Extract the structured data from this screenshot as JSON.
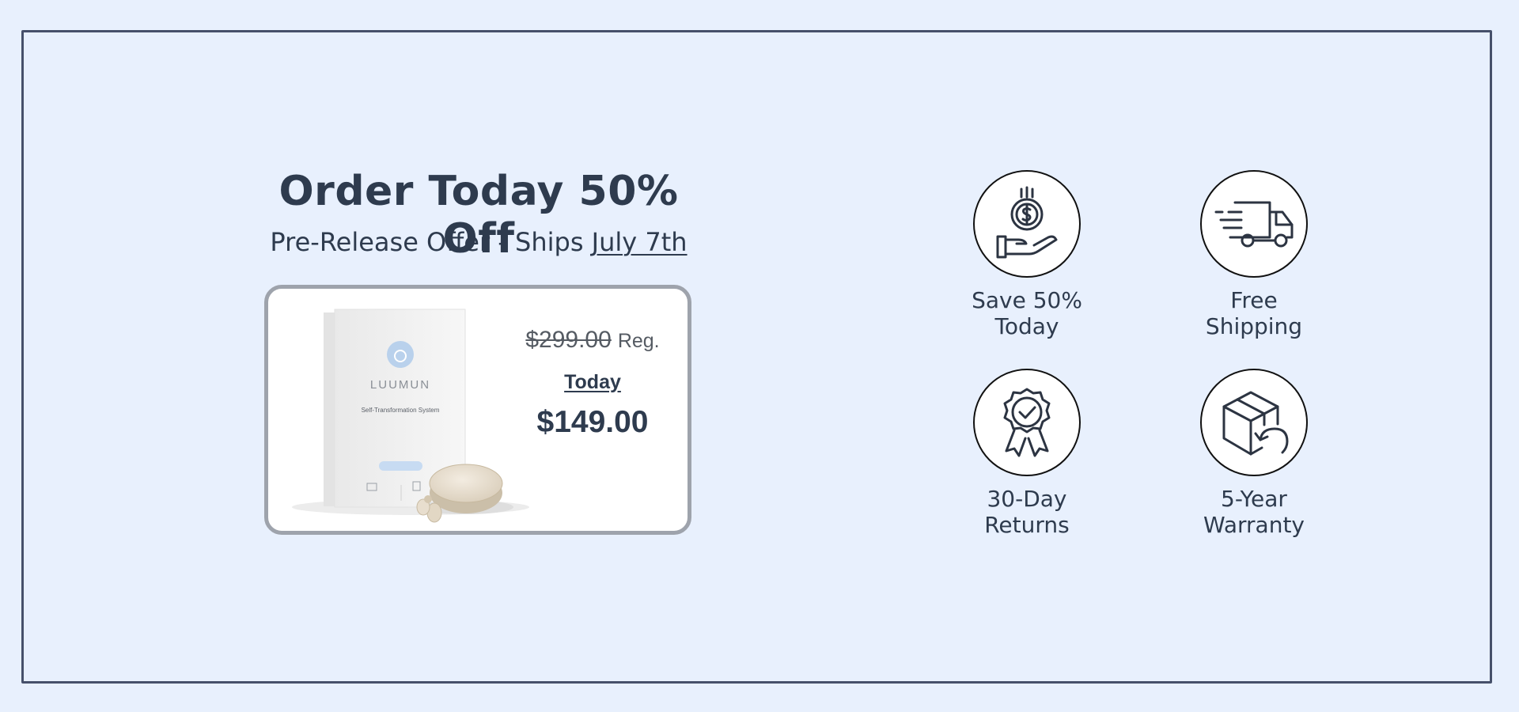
{
  "offer": {
    "headline": "Order Today 50% Off",
    "subhead_prefix": "Pre-Release Offer - Ships ",
    "ship_date": "July 7th"
  },
  "product": {
    "brand": "LUUMUN",
    "box_subtitle": "Self-Transformation System",
    "regular_price": "$299.00",
    "regular_label": "Reg.",
    "today_label": "Today",
    "today_price": "$149.00"
  },
  "features": [
    {
      "icon": "hand-coin-icon",
      "line1": "Save 50%",
      "line2": "Today"
    },
    {
      "icon": "delivery-truck-icon",
      "line1": "Free",
      "line2": "Shipping"
    },
    {
      "icon": "award-badge-icon",
      "line1": "30-Day",
      "line2": "Returns"
    },
    {
      "icon": "box-return-icon",
      "line1": "5-Year",
      "line2": "Warranty"
    }
  ],
  "colors": {
    "background": "#e8f0fd",
    "text": "#2e3b4e",
    "frame": "#46506a",
    "card_border": "#9ea3ac"
  }
}
